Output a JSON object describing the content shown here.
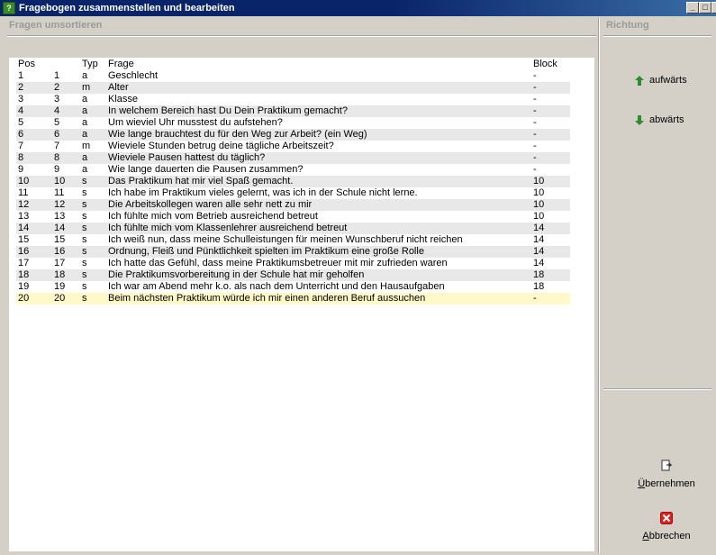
{
  "window": {
    "title": "Fragebogen zusammenstellen und bearbeiten",
    "icon_text": "?",
    "controls": {
      "minimize": "_",
      "maximize": "□",
      "close": "×"
    }
  },
  "left_section": {
    "title": "Fragen umsortieren"
  },
  "right_section": {
    "title": "Richtung"
  },
  "table": {
    "headers": {
      "pos": "Pos",
      "typ": "Typ",
      "frage": "Frage",
      "block": "Block"
    },
    "rows": [
      {
        "pos": "1",
        "nr": "1",
        "typ": "a",
        "frage": "Geschlecht",
        "block": "-"
      },
      {
        "pos": "2",
        "nr": "2",
        "typ": "m",
        "frage": "Alter",
        "block": "-"
      },
      {
        "pos": "3",
        "nr": "3",
        "typ": "a",
        "frage": "Klasse",
        "block": "-"
      },
      {
        "pos": "4",
        "nr": "4",
        "typ": "a",
        "frage": "In welchem Bereich hast Du Dein Praktikum gemacht?",
        "block": "-"
      },
      {
        "pos": "5",
        "nr": "5",
        "typ": "a",
        "frage": "Um wieviel Uhr musstest du aufstehen?",
        "block": "-"
      },
      {
        "pos": "6",
        "nr": "6",
        "typ": "a",
        "frage": "Wie lange brauchtest du für den Weg zur Arbeit? (ein Weg)",
        "block": "-"
      },
      {
        "pos": "7",
        "nr": "7",
        "typ": "m",
        "frage": "Wieviele Stunden betrug deine tägliche Arbeitszeit?",
        "block": "-"
      },
      {
        "pos": "8",
        "nr": "8",
        "typ": "a",
        "frage": "Wieviele Pausen hattest du täglich?",
        "block": "-"
      },
      {
        "pos": "9",
        "nr": "9",
        "typ": "a",
        "frage": "Wie lange dauerten die Pausen zusammen?",
        "block": "-"
      },
      {
        "pos": "10",
        "nr": "10",
        "typ": "s",
        "frage": "Das Praktikum hat mir viel Spaß gemacht.",
        "block": "10"
      },
      {
        "pos": "11",
        "nr": "11",
        "typ": "s",
        "frage": "Ich habe im Praktikum vieles gelernt, was ich in der Schule nicht lerne.",
        "block": "10"
      },
      {
        "pos": "12",
        "nr": "12",
        "typ": "s",
        "frage": "Die Arbeitskollegen waren alle sehr nett zu mir",
        "block": "10"
      },
      {
        "pos": "13",
        "nr": "13",
        "typ": "s",
        "frage": "Ich fühlte mich vom Betrieb ausreichend betreut",
        "block": "10"
      },
      {
        "pos": "14",
        "nr": "14",
        "typ": "s",
        "frage": "Ich fühlte mich vom Klassenlehrer ausreichend betreut",
        "block": "14"
      },
      {
        "pos": "15",
        "nr": "15",
        "typ": "s",
        "frage": "Ich weiß nun, dass meine Schulleistungen für meinen Wunschberuf nicht reichen",
        "block": "14"
      },
      {
        "pos": "16",
        "nr": "16",
        "typ": "s",
        "frage": "Ordnung, Fleiß und Pünktlichkeit spielten im Praktikum eine große Rolle",
        "block": "14"
      },
      {
        "pos": "17",
        "nr": "17",
        "typ": "s",
        "frage": "Ich hatte das Gefühl, dass meine Praktikumsbetreuer mit mir zufrieden waren",
        "block": "14"
      },
      {
        "pos": "18",
        "nr": "18",
        "typ": "s",
        "frage": "Die Praktikumsvorbereitung in der Schule hat mir geholfen",
        "block": "18"
      },
      {
        "pos": "19",
        "nr": "19",
        "typ": "s",
        "frage": "Ich war am Abend mehr k.o. als nach dem Unterricht und den Hausaufgaben",
        "block": "18"
      },
      {
        "pos": "20",
        "nr": "20",
        "typ": "s",
        "frage": "Beim nächsten Praktikum würde ich mir einen anderen Beruf aussuchen",
        "block": "-"
      }
    ],
    "selected_row": "20"
  },
  "direction": {
    "up_label": "aufwärts",
    "down_label": "abwärts",
    "arrow_color": "#2e8b2e"
  },
  "actions": {
    "apply_label_first": "Ü",
    "apply_label_rest": "bernehmen",
    "cancel_label_first": "A",
    "cancel_label_rest": "bbrechen",
    "cancel_color": "#e02020"
  }
}
